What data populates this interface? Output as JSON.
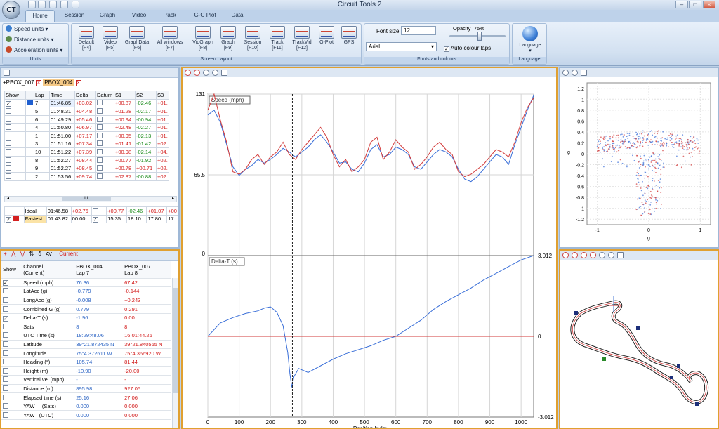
{
  "app": {
    "title": "Circuit Tools 2",
    "logo": "CT"
  },
  "tabs": [
    "Home",
    "Session",
    "Graph",
    "Video",
    "Track",
    "G-G Plot",
    "Data"
  ],
  "ribbon": {
    "units": {
      "items": [
        "Speed units",
        "Distance units",
        "Acceleration units"
      ],
      "label": "Units"
    },
    "layout_buttons": [
      {
        "label": "Default",
        "key": "[F4]"
      },
      {
        "label": "Video",
        "key": "[F5]"
      },
      {
        "label": "GraphData",
        "key": "[F6]"
      },
      {
        "label": "All windows",
        "key": "[F7]"
      },
      {
        "label": "VidGraph",
        "key": "[F8]"
      },
      {
        "label": "Graph",
        "key": "[F9]"
      },
      {
        "label": "Session",
        "key": "[F10]"
      },
      {
        "label": "Track",
        "key": "[F11]"
      },
      {
        "label": "TrackVid",
        "key": "[F12]"
      },
      {
        "label": "G-Plot",
        "key": ""
      },
      {
        "label": "GPS",
        "key": ""
      }
    ],
    "layout_label": "Screen Layout",
    "fonts": {
      "font_size_label": "Font size",
      "font_size": "12",
      "opacity_label": "Opacity",
      "opacity": "75%",
      "font": "Arial",
      "auto_colour": "Auto colour laps",
      "label": "Fonts and colours"
    },
    "language": {
      "button": "Language",
      "label": "Language"
    }
  },
  "sessions": {
    "a": "+PBOX_007",
    "b": "PBOX_004"
  },
  "laps_table": {
    "headers": [
      "Show",
      "Lap",
      "Time",
      "Delta",
      "Datum",
      "S1",
      "S2",
      "S3"
    ],
    "rows": [
      {
        "show": true,
        "color": "#1f5fd0",
        "lap": "7",
        "time": "01:46.85",
        "delta": "+03.02",
        "s1": "+00.87",
        "s2": "-02.46",
        "s3": "+01.",
        "highlight": true
      },
      {
        "show": false,
        "color": "",
        "lap": "5",
        "time": "01:48.31",
        "delta": "+04.48",
        "s1": "+01.28",
        "s2": "-02.17",
        "s3": "+01."
      },
      {
        "show": false,
        "color": "",
        "lap": "6",
        "time": "01:49.29",
        "delta": "+05.46",
        "s1": "+00.94",
        "s2": "-00.94",
        "s3": "+01."
      },
      {
        "show": false,
        "color": "",
        "lap": "4",
        "time": "01:50.80",
        "delta": "+06.97",
        "s1": "+02.48",
        "s2": "-02.27",
        "s3": "+01."
      },
      {
        "show": false,
        "color": "",
        "lap": "1",
        "time": "01:51.00",
        "delta": "+07.17",
        "s1": "+00.95",
        "s2": "-02.13",
        "s3": "+01."
      },
      {
        "show": false,
        "color": "",
        "lap": "3",
        "time": "01:51.16",
        "delta": "+07.34",
        "s1": "+01.41",
        "s2": "-01.42",
        "s3": "+02."
      },
      {
        "show": false,
        "color": "",
        "lap": "10",
        "time": "01:51.22",
        "delta": "+07.39",
        "s1": "+00.98",
        "s2": "-02.14",
        "s3": "+04."
      },
      {
        "show": false,
        "color": "",
        "lap": "8",
        "time": "01:52.27",
        "delta": "+08.44",
        "s1": "+00.77",
        "s2": "-01.92",
        "s3": "+02."
      },
      {
        "show": false,
        "color": "",
        "lap": "9",
        "time": "01:52.27",
        "delta": "+08.45",
        "s1": "+00.78",
        "s2": "+00.71",
        "s3": "+02."
      },
      {
        "show": false,
        "color": "",
        "lap": "2",
        "time": "01:53.56",
        "delta": "+09.74",
        "s1": "+02.87",
        "s2": "-00.88",
        "s3": "+02."
      }
    ],
    "scroll_glyph": "III",
    "ideal": {
      "label": "Ideal",
      "time": "01:46.58",
      "delta": "+02.76",
      "s1": "+00.77",
      "s2": "-02.46",
      "s3": "+01.07",
      "s4": "+00"
    },
    "fastest": {
      "label": "Fastest",
      "time": "01:43.82",
      "delta": "00.00",
      "s1": "15.35",
      "s2": "18.10",
      "s3": "17.80",
      "s4": "17"
    }
  },
  "channel_toolbar": {
    "current": "Current"
  },
  "channels": {
    "headers": {
      "show": "Show",
      "channel": "Channel\n(Current)",
      "a": "PBOX_004\nLap 7",
      "b": "PBOX_007\nLap 8"
    },
    "rows": [
      {
        "show": true,
        "name": "Speed (mph)",
        "a": "76.36",
        "b": "67.42"
      },
      {
        "show": false,
        "name": "LatAcc (g)",
        "a": "-0.779",
        "b": "-0.144"
      },
      {
        "show": false,
        "name": "LongAcc (g)",
        "a": "-0.008",
        "b": "+0.243"
      },
      {
        "show": false,
        "name": "Combined G (g)",
        "a": "0.779",
        "b": "0.291"
      },
      {
        "show": true,
        "name": "Delta-T (s)",
        "a": "-1.96",
        "b": "0.00"
      },
      {
        "show": false,
        "name": "Sats",
        "a": "8",
        "b": "8"
      },
      {
        "show": false,
        "name": "UTC Time (s)",
        "a": "18:29:48.06",
        "b": "16:01:44.26"
      },
      {
        "show": false,
        "name": "Latitude",
        "a": "39°21.872435 N",
        "b": "39°21.840565 N"
      },
      {
        "show": false,
        "name": "Longitude",
        "a": "75°4.372611 W",
        "b": "75°4.366920 W"
      },
      {
        "show": false,
        "name": "Heading (°)",
        "a": "105.74",
        "b": "81.44"
      },
      {
        "show": false,
        "name": "Height (m)",
        "a": "-10.90",
        "b": "-20.00"
      },
      {
        "show": false,
        "name": "Vertical vel (mph)",
        "a": "-",
        "b": "-"
      },
      {
        "show": false,
        "name": "Distance (m)",
        "a": "895.98",
        "b": "927.05"
      },
      {
        "show": false,
        "name": "Elapsed time (s)",
        "a": "25.16",
        "b": "27.06"
      },
      {
        "show": false,
        "name": "YAW__ (Sats)",
        "a": "0.000",
        "b": "0.000"
      },
      {
        "show": false,
        "name": "YAW_ (UTC)",
        "a": "0.000",
        "b": "0.000"
      }
    ]
  },
  "colors": {
    "lap_a": "#3a6fd8",
    "lap_b": "#d23a3a",
    "accent_border": "#e0a030"
  },
  "chart_data": [
    {
      "type": "line",
      "title": "Speed (mph)",
      "ylim": [
        0,
        131
      ],
      "y_ticks": [
        "131",
        "65.5",
        "0"
      ],
      "cursor_x": 270,
      "series": [
        {
          "name": "",
          "color": "#3a6fd8",
          "x": [
            0,
            20,
            40,
            60,
            80,
            100,
            120,
            140,
            160,
            180,
            200,
            220,
            240,
            260,
            280,
            300,
            320,
            340,
            360,
            380,
            400,
            420,
            440,
            460,
            480,
            500,
            520,
            540,
            560,
            580,
            600,
            620,
            640,
            660,
            680,
            700,
            720,
            740,
            760,
            780,
            800,
            820,
            840,
            860,
            880,
            900,
            920,
            940,
            960,
            980,
            1000,
            1020,
            1040
          ],
          "values": [
            114,
            118,
            108,
            90,
            72,
            65,
            70,
            73,
            78,
            75,
            78,
            82,
            87,
            84,
            80,
            84,
            88,
            94,
            98,
            92,
            84,
            75,
            76,
            70,
            68,
            75,
            86,
            90,
            80,
            82,
            88,
            86,
            82,
            72,
            70,
            76,
            82,
            86,
            84,
            80,
            70,
            62,
            60,
            64,
            70,
            76,
            82,
            80,
            74,
            90,
            104,
            118,
            130
          ]
        },
        {
          "name": "",
          "color": "#d23a3a",
          "x": [
            0,
            20,
            40,
            60,
            80,
            100,
            120,
            140,
            160,
            180,
            200,
            220,
            240,
            260,
            280,
            300,
            320,
            340,
            360,
            380,
            400,
            420,
            440,
            460,
            480,
            500,
            520,
            540,
            560,
            580,
            600,
            620,
            640,
            660,
            680,
            700,
            720,
            740,
            760,
            780,
            800,
            820,
            840,
            860,
            880,
            900,
            920,
            940,
            960,
            980,
            1000,
            1020,
            1040
          ],
          "values": [
            118,
            131,
            110,
            92,
            68,
            66,
            70,
            78,
            82,
            74,
            80,
            84,
            92,
            82,
            78,
            86,
            92,
            98,
            104,
            96,
            82,
            72,
            78,
            68,
            72,
            78,
            92,
            96,
            78,
            84,
            94,
            88,
            84,
            70,
            74,
            80,
            88,
            92,
            86,
            82,
            68,
            64,
            66,
            70,
            74,
            80,
            86,
            84,
            80,
            92,
            108,
            120,
            128
          ]
        }
      ]
    },
    {
      "type": "line",
      "title": "Delta-T (s)",
      "ylim": [
        -3.012,
        3.012
      ],
      "y_ticks": [
        "3.012",
        "0",
        "-3.012"
      ],
      "x_ticks": [
        0,
        100,
        200,
        300,
        400,
        500,
        600,
        700,
        800,
        900,
        1000
      ],
      "xlabel": "Position Index",
      "series": [
        {
          "name": "",
          "color": "#3a6fd8",
          "x": [
            0,
            40,
            80,
            120,
            160,
            180,
            200,
            220,
            240,
            255,
            262,
            268,
            275,
            290,
            320,
            360,
            400,
            440,
            480,
            520,
            560,
            600,
            640,
            680,
            720,
            760,
            800,
            840,
            880,
            920,
            960,
            1000,
            1040
          ],
          "values": [
            0,
            0.5,
            0.7,
            0.85,
            0.95,
            1.05,
            1.1,
            0.9,
            0.4,
            -0.6,
            -1.4,
            -1.9,
            -1.5,
            -1.2,
            -1.35,
            -1.1,
            -0.85,
            -0.65,
            -0.5,
            -0.35,
            -0.15,
            0,
            0.3,
            0.6,
            1.0,
            1.3,
            1.55,
            1.8,
            2.1,
            2.35,
            2.6,
            2.85,
            3.012
          ]
        },
        {
          "name": "",
          "color": "#d23a3a",
          "x": [
            0,
            1040
          ],
          "values": [
            0,
            0
          ]
        }
      ]
    },
    {
      "type": "scatter",
      "title": "",
      "xlabel": "g",
      "ylabel": "g",
      "xlim": [
        -1.2,
        1.2
      ],
      "ylim": [
        -1.3,
        1.3
      ],
      "y_ticks": [
        "1.2",
        "1",
        "0.8",
        "0.6",
        "0.4",
        "0.2",
        "0",
        "-0.2",
        "-0.4",
        "-0.6",
        "-0.8",
        "-1",
        "-1.2"
      ],
      "x_ticks": [
        "-1",
        "0",
        "1"
      ],
      "series": [
        {
          "name": "",
          "color": "#3a6fd8",
          "points": 260
        },
        {
          "name": "",
          "color": "#d23a3a",
          "points": 220
        }
      ]
    }
  ]
}
